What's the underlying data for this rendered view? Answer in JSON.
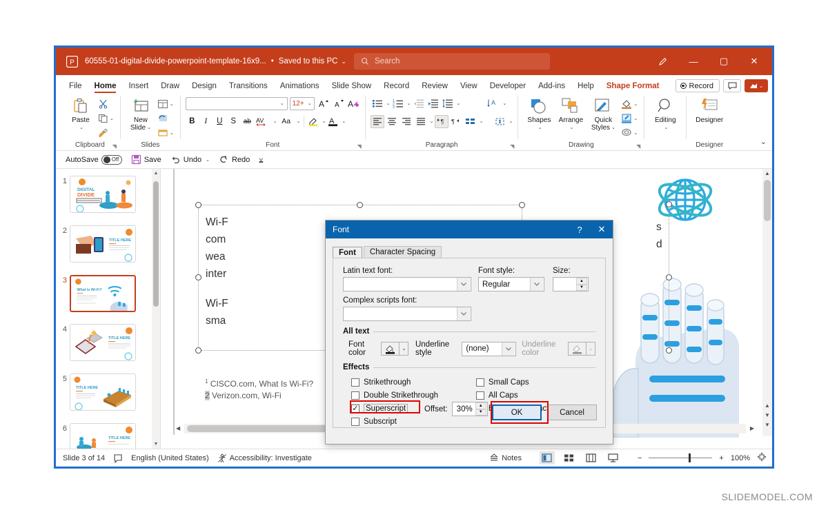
{
  "titlebar": {
    "filename": "60555-01-digital-divide-powerpoint-template-16x9...",
    "saved_state": "Saved to this PC",
    "dot": "•",
    "chevron": "⌄",
    "search_placeholder": "Search",
    "search_icon": "search-icon",
    "pen_icon": "pen-icon",
    "minimize": "—",
    "maximize": "▢",
    "close": "✕"
  },
  "tabs": [
    {
      "label": "File",
      "active": false,
      "accent": false
    },
    {
      "label": "Home",
      "active": true,
      "accent": false
    },
    {
      "label": "Insert",
      "active": false,
      "accent": false
    },
    {
      "label": "Draw",
      "active": false,
      "accent": false
    },
    {
      "label": "Design",
      "active": false,
      "accent": false
    },
    {
      "label": "Transitions",
      "active": false,
      "accent": false
    },
    {
      "label": "Animations",
      "active": false,
      "accent": false
    },
    {
      "label": "Slide Show",
      "active": false,
      "accent": false
    },
    {
      "label": "Record",
      "active": false,
      "accent": false
    },
    {
      "label": "Review",
      "active": false,
      "accent": false
    },
    {
      "label": "View",
      "active": false,
      "accent": false
    },
    {
      "label": "Developer",
      "active": false,
      "accent": false
    },
    {
      "label": "Add-ins",
      "active": false,
      "accent": false
    },
    {
      "label": "Help",
      "active": false,
      "accent": false
    },
    {
      "label": "Shape Format",
      "active": false,
      "accent": true
    }
  ],
  "tabbar_right": {
    "record_label": "Record",
    "comments_icon": "comment-icon",
    "share_icon": "share-icon",
    "share_chevron": "⌄"
  },
  "ribbon": {
    "clipboard": {
      "group_label": "Clipboard",
      "paste_label": "Paste",
      "cut_icon": "scissors-icon",
      "copy_icon": "copy-icon",
      "format_painter_icon": "format-painter-icon"
    },
    "slides": {
      "group_label": "Slides",
      "new_slide_label": "New\nSlide",
      "layout_icon": "layout-icon",
      "reset_icon": "reset-icon",
      "section_icon": "section-icon"
    },
    "font": {
      "group_label": "Font",
      "font_name": "",
      "font_size": "12+",
      "grow_font": "A",
      "shrink_font": "A",
      "clear_formatting": "A",
      "bold": "B",
      "italic": "I",
      "underline": "U",
      "shadow": "S",
      "strikethrough": "ab",
      "char_spacing": "AV",
      "change_case": "Aa",
      "highlight_icon": "text-highlight-icon",
      "font_color_icon": "font-color-icon"
    },
    "paragraph": {
      "group_label": "Paragraph",
      "bullets_icon": "bullets-icon",
      "numbering_icon": "numbering-icon",
      "decrease_indent_icon": "decrease-indent-icon",
      "increase_indent_icon": "increase-indent-icon",
      "line_spacing_icon": "line-spacing-icon",
      "align_left_icon": "align-left-icon",
      "align_center_icon": "align-center-icon",
      "align_right_icon": "align-right-icon",
      "justify_icon": "justify-icon",
      "text_direction_icon": "text-direction-icon",
      "align_text_icon": "align-text-icon",
      "smartart_icon": "convert-to-smartart-icon",
      "text_dir_vertical_icon": "text-direction-vertical-icon",
      "align_text_box_icon": "align-text-box-icon"
    },
    "drawing": {
      "group_label": "Drawing",
      "shapes_label": "Shapes",
      "arrange_label": "Arrange",
      "quick_styles_label": "Quick\nStyles",
      "shape_fill_icon": "shape-fill-icon",
      "shape_outline_icon": "shape-outline-icon",
      "shape_effects_icon": "shape-effects-icon"
    },
    "editing": {
      "editing_label": "Editing",
      "find_icon": "magnifier-icon"
    },
    "designer": {
      "group_label": "Designer",
      "designer_label": "Designer"
    },
    "collapse_chevron": "⌄"
  },
  "qat": {
    "autosave_label": "AutoSave",
    "autosave_state": "Off",
    "save_label": "Save",
    "undo_label": "Undo",
    "redo_label": "Redo",
    "more_icon": "more-commands-icon"
  },
  "thumbnails": [
    {
      "number": "1",
      "selected": false
    },
    {
      "number": "2",
      "selected": false
    },
    {
      "number": "3",
      "selected": true
    },
    {
      "number": "4",
      "selected": false
    },
    {
      "number": "5",
      "selected": false
    },
    {
      "number": "6",
      "selected": false
    }
  ],
  "slide": {
    "body_lines": [
      "Wi-F",
      "com",
      "wea",
      "inter"
    ],
    "body_lines2": [
      "Wi-F",
      "sma"
    ],
    "footnote1": "CISCO.com, What Is Wi-Fi?",
    "footnote1_marker": "1",
    "footnote2": "Verizon.com, Wi-Fi",
    "footnote2_marker": "2",
    "right_edge_text": [
      "s",
      "d"
    ]
  },
  "font_dialog": {
    "title": "Font",
    "help": "?",
    "close": "✕",
    "tabs": [
      {
        "label": "Font",
        "active": true
      },
      {
        "label": "Character Spacing",
        "active": false
      }
    ],
    "latin_font_label": "Latin text font:",
    "latin_font_value": "",
    "complex_font_label": "Complex scripts font:",
    "complex_font_value": "",
    "font_style_label": "Font style:",
    "font_style_value": "Regular",
    "size_label": "Size:",
    "size_value": "",
    "all_text_label": "All text",
    "font_color_label": "Font color",
    "underline_style_label": "Underline style",
    "underline_style_value": "(none)",
    "underline_color_label": "Underline color",
    "effects_label": "Effects",
    "effects": [
      {
        "label": "Strikethrough",
        "checked": false,
        "highlighted": false
      },
      {
        "label": "Double Strikethrough",
        "checked": false,
        "highlighted": false
      },
      {
        "label": "Superscript",
        "checked": true,
        "highlighted": true
      },
      {
        "label": "Subscript",
        "checked": false,
        "highlighted": false
      },
      {
        "label": "Small Caps",
        "checked": false,
        "highlighted": false
      },
      {
        "label": "All Caps",
        "checked": false,
        "highlighted": false
      },
      {
        "label": "Equalize Character Height",
        "checked": false,
        "highlighted": false
      }
    ],
    "offset_label": "Offset:",
    "offset_value": "30%",
    "ok_label": "OK",
    "cancel_label": "Cancel"
  },
  "statusbar": {
    "slide_count": "Slide 3 of 14",
    "spellcheck_icon": "spellcheck-icon",
    "language": "English (United States)",
    "accessibility_icon": "accessibility-icon",
    "accessibility": "Accessibility: Investigate",
    "notes_label": "Notes",
    "view_normal_icon": "normal-view-icon",
    "view_sorter_icon": "slide-sorter-icon",
    "view_reading_icon": "reading-view-icon",
    "view_slideshow_icon": "slideshow-icon",
    "zoom_out": "−",
    "zoom_in": "+",
    "zoom_value": "100%",
    "fit_icon": "fit-to-window-icon"
  },
  "watermark": "SLIDEMODEL.COM",
  "colors": {
    "powerpoint_orange": "#c43e1c",
    "frame_blue": "#1f6fd0",
    "dialog_blue": "#0a64ad",
    "annotation_red": "#e00000"
  }
}
